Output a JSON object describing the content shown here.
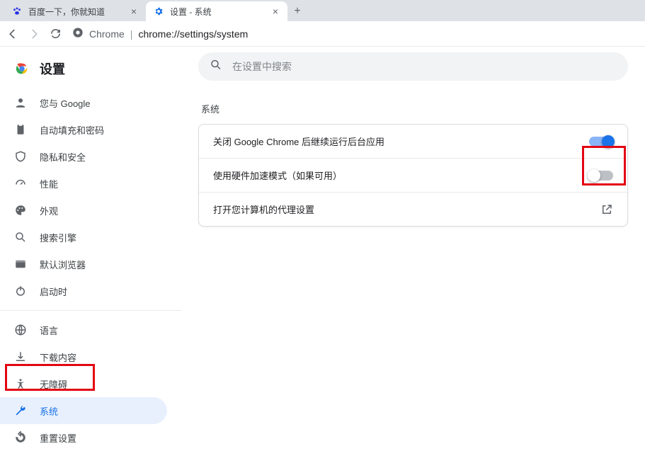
{
  "tabs": [
    {
      "title": "百度一下，你就知道",
      "favicon": "baidu"
    },
    {
      "title": "设置 - 系统",
      "favicon": "gear"
    }
  ],
  "address": {
    "origin": "Chrome",
    "path": "chrome://settings/system"
  },
  "header": {
    "title": "设置"
  },
  "search": {
    "placeholder": "在设置中搜索"
  },
  "sidebar": {
    "items_top": [
      {
        "label": "您与 Google"
      },
      {
        "label": "自动填充和密码"
      },
      {
        "label": "隐私和安全"
      },
      {
        "label": "性能"
      },
      {
        "label": "外观"
      },
      {
        "label": "搜索引擎"
      },
      {
        "label": "默认浏览器"
      },
      {
        "label": "启动时"
      }
    ],
    "items_bottom": [
      {
        "label": "语言"
      },
      {
        "label": "下载内容"
      },
      {
        "label": "无障碍"
      },
      {
        "label": "系统"
      },
      {
        "label": "重置设置"
      }
    ]
  },
  "section": {
    "title": "系统",
    "rows": [
      {
        "label": "关闭 Google Chrome 后继续运行后台应用",
        "toggle": true
      },
      {
        "label": "使用硬件加速模式（如果可用）",
        "toggle": false
      },
      {
        "label": "打开您计算机的代理设置",
        "external": true
      }
    ]
  }
}
